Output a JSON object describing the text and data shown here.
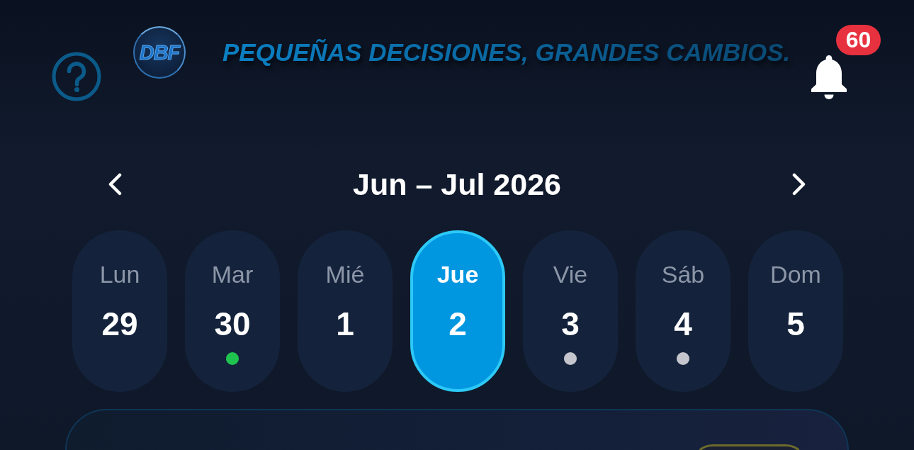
{
  "header": {
    "logo": {
      "text": "DBF"
    },
    "slogan": "PEQUEÑAS DECISIONES, GRANDES CAMBIOS.",
    "notifications": {
      "count": "60"
    }
  },
  "calendar": {
    "range": "Jun – Jul 2026",
    "days": [
      {
        "weekday": "Lun",
        "date": "29",
        "selected": false
      },
      {
        "weekday": "Mar",
        "date": "30",
        "selected": false,
        "color": "#1fc44f"
      },
      {
        "weekday": "Mié",
        "date": "1",
        "selected": false
      },
      {
        "weekday": "Jue",
        "date": "2",
        "selected": true
      },
      {
        "weekday": "Vie",
        "date": "3",
        "selected": false,
        "color": "#c5c5cd"
      },
      {
        "weekday": "Sáb",
        "date": "4",
        "selected": false,
        "color": "#c5c5cd"
      },
      {
        "weekday": "Dom",
        "date": "5",
        "selected": false
      }
    ]
  }
}
